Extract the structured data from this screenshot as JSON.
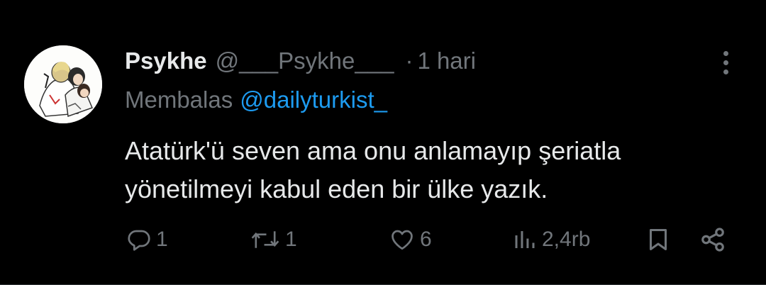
{
  "tweet": {
    "display_name": "Psykhe",
    "handle": "@___Psykhe___",
    "separator": "·",
    "time": "1 hari",
    "reply_prefix": "Membalas",
    "reply_to": "@dailyturkist_",
    "text_lines": [
      "Atatürk'ü seven ama onu anlamayıp şeriatla",
      "yönetilmeyi kabul eden bir ülke yazık."
    ]
  },
  "actions": {
    "replies": "1",
    "reposts": "1",
    "likes": "6",
    "views": "2,4rb"
  },
  "icons": {
    "more": "more-vertical-icon",
    "reply": "reply-bubble-icon",
    "repost": "repost-icon",
    "like": "heart-icon",
    "views": "views-bar-chart-icon",
    "bookmark": "bookmark-icon",
    "share": "share-icon"
  },
  "colors": {
    "background": "#000000",
    "primary_text": "#e7e9ea",
    "secondary_text": "#71767b",
    "accent": "#1d9bf0"
  }
}
